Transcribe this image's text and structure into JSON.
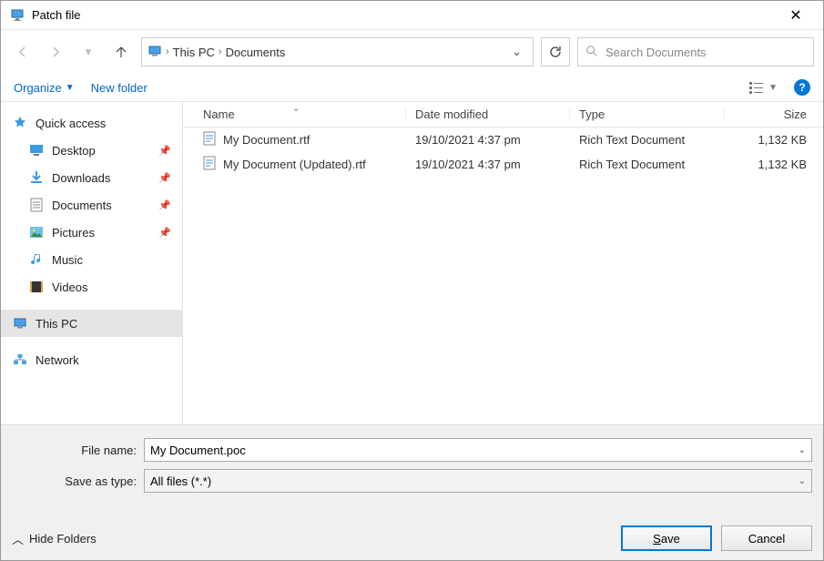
{
  "titlebar": {
    "title": "Patch file"
  },
  "breadcrumb": {
    "parts": [
      "This PC",
      "Documents"
    ]
  },
  "search": {
    "placeholder": "Search Documents"
  },
  "toolbar": {
    "organize": "Organize",
    "newfolder": "New folder"
  },
  "columns": {
    "name": "Name",
    "date": "Date modified",
    "type": "Type",
    "size": "Size"
  },
  "files": [
    {
      "name": "My Document.rtf",
      "date": "19/10/2021 4:37 pm",
      "type": "Rich Text Document",
      "size": "1,132 KB"
    },
    {
      "name": "My Document (Updated).rtf",
      "date": "19/10/2021 4:37 pm",
      "type": "Rich Text Document",
      "size": "1,132 KB"
    }
  ],
  "sidebar": {
    "quickaccess": "Quick access",
    "desktop": "Desktop",
    "downloads": "Downloads",
    "documents": "Documents",
    "pictures": "Pictures",
    "music": "Music",
    "videos": "Videos",
    "thispc": "This PC",
    "network": "Network"
  },
  "footer": {
    "filename_label": "File name:",
    "filename_value": "My Document.poc",
    "saveas_label": "Save as type:",
    "saveas_value": "All files (*.*)",
    "hide": "Hide Folders",
    "save": "Save",
    "cancel": "Cancel"
  }
}
